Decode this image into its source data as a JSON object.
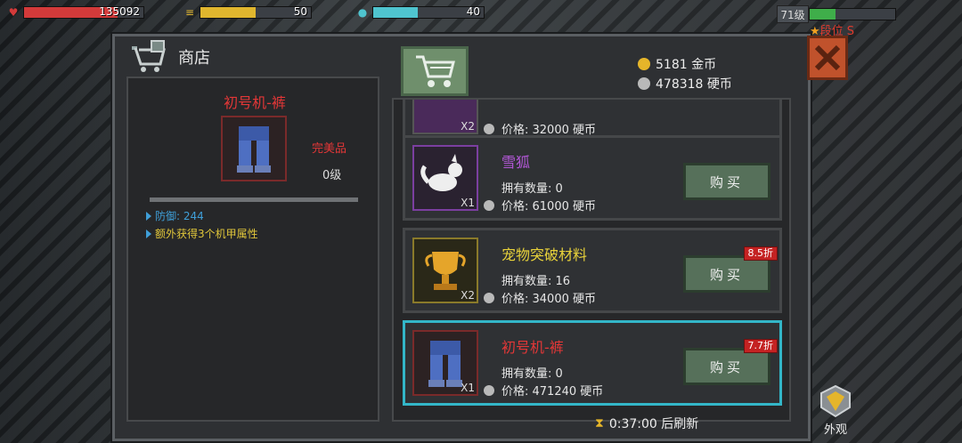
{
  "hud": {
    "hp": {
      "value": "135092",
      "color": "#d33a3a",
      "fill": 0.78
    },
    "energy": {
      "value": "50",
      "color": "#e0b62e",
      "fill": 0.5
    },
    "water": {
      "value": "40",
      "color": "#4fc4cf",
      "fill": 0.4
    },
    "level": "71级",
    "rank": "段位 S"
  },
  "shop": {
    "title": "商店",
    "gold": "5181 金币",
    "silver": "478318 硬币",
    "refresh": "0:37:00 后刷新",
    "appearance_label": "外观"
  },
  "detail": {
    "name": "初号机-裤",
    "quality": "完美品",
    "level": "0级",
    "stats": [
      "防御: 244",
      "额外获得3个机甲属性"
    ]
  },
  "items": [
    {
      "name": "",
      "own": "",
      "price": "价格: 32000 硬币",
      "qty": "X2",
      "buy": "",
      "discount": ""
    },
    {
      "name": "雪狐",
      "own": "拥有数量: 0",
      "price": "价格: 61000 硬币",
      "qty": "X1",
      "buy": "购买",
      "discount": "",
      "name_color": "#b257d6"
    },
    {
      "name": "宠物突破材料",
      "own": "拥有数量: 16",
      "price": "价格: 34000 硬币",
      "qty": "X2",
      "buy": "购买",
      "discount": "8.5折",
      "name_color": "#e8d23a"
    },
    {
      "name": "初号机-裤",
      "own": "拥有数量: 0",
      "price": "价格: 471240 硬币",
      "qty": "X1",
      "buy": "购买",
      "discount": "7.7折",
      "name_color": "#e33737"
    }
  ]
}
